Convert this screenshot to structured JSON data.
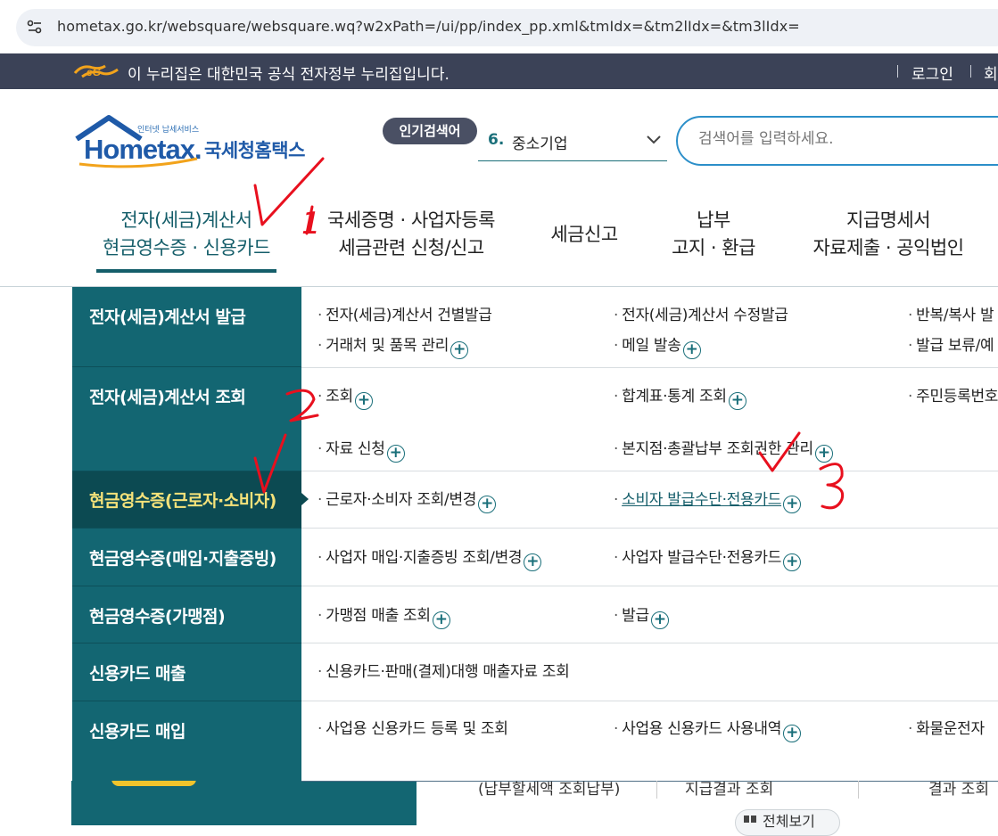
{
  "browser": {
    "url": "hometax.go.kr/websquare/websquare.wq?w2xPath=/ui/pp/index_pp.xml&tmIdx=&tm2lIdx=&tm3lIdx="
  },
  "gov_bar": {
    "notice": "이 누리집은 대한민국 공식 전자정부 누리집입니다.",
    "login": "로그인",
    "join": "회"
  },
  "header": {
    "logo_small": "인터넷 납세서비스",
    "logo_home": "Hometax.",
    "logo_kr": "국세청홈택스",
    "popular_badge": "인기검색어",
    "popular_rank": "6.",
    "popular_term": "중소기업",
    "search_placeholder": "검색어를 입력하세요."
  },
  "main_nav": [
    {
      "line1": "전자(세금)계산서",
      "line2": "현금영수증 · 신용카드"
    },
    {
      "line1": "국세증명 · 사업자등록",
      "line2": "세금관련 신청/신고"
    },
    {
      "line1": "세금신고",
      "line2": ""
    },
    {
      "line1": "납부",
      "line2": "고지 · 환급"
    },
    {
      "line1": "지급명세서",
      "line2": "자료제출 · 공익법인"
    }
  ],
  "left_menu": [
    "전자(세금)계산서 발급",
    "전자(세금)계산서 조회",
    "현금영수증(근로자·소비자)",
    "현금영수증(매입·지출증빙)",
    "현금영수증(가맹점)",
    "신용카드 매출",
    "신용카드 매입"
  ],
  "submenu": {
    "issue": [
      "전자(세금)계산서 건별발급",
      "전자(세금)계산서 수정발급",
      "반복/복사 발",
      "거래처 및 품목 관리",
      "메일 발송",
      "발급 보류/예"
    ],
    "inquiry": [
      "조회",
      "합계표·통계 조회",
      "주민등록번호",
      "자료 신청",
      "본지점·총괄납부 조회권한 관리"
    ],
    "consumer": [
      "근로자·소비자 조회/변경",
      "소비자 발급수단·전용카드"
    ],
    "business": [
      "사업자 매입·지출증빙 조회/변경",
      "사업자 발급수단·전용카드"
    ],
    "merchant": [
      "가맹점 매출 조회",
      "발급"
    ],
    "card_sales": [
      "신용카드·판매(결제)대행 매출자료 조회"
    ],
    "card_purchase": [
      "사업용 신용카드 등록 및 조회",
      "사업용 신용카드 사용내역",
      "화물운전자 "
    ]
  },
  "background": {
    "text1": "(납부할세액 조회납부)",
    "text2": "지급결과 조회",
    "text3": "결과 조회",
    "view_all": "전체보기"
  },
  "annotations": [
    "1",
    "2",
    "3"
  ],
  "colors": {
    "teal": "#136672",
    "teal_dark": "#0c4a52",
    "active_text": "#f5e27a",
    "red_mark": "#e8101e"
  }
}
